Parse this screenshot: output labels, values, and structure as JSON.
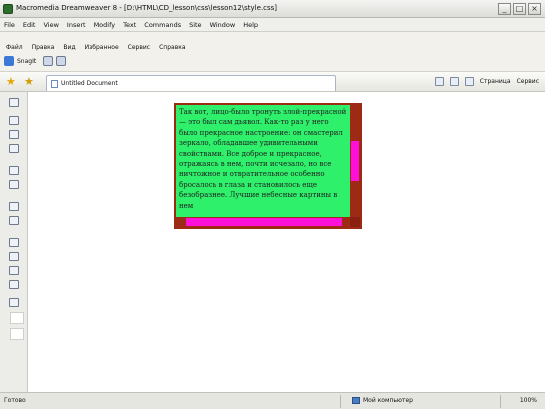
{
  "window": {
    "title": "Macromedia Dreamweaver 8 - [D:\\HTML\\CD_lesson\\css\\lesson12\\style.css]",
    "controls": [
      "_",
      "□",
      "×"
    ]
  },
  "dw_menu": [
    "File",
    "Edit",
    "View",
    "Insert",
    "Modify",
    "Text",
    "Commands",
    "Site",
    "Window",
    "Help"
  ],
  "ie_menu": [
    "Файл",
    "Правка",
    "Вид",
    "Избранное",
    "Сервис",
    "Справка"
  ],
  "ie_toolbar": {
    "snagit_label": "SnagIt"
  },
  "tab": {
    "title": "Untitled Document"
  },
  "ie_commands": {
    "page_label": "Страница",
    "tools_label": "Сервис"
  },
  "demo_box": {
    "text": "Так вот, лицо-было тронуть злой-прекрасной — это был сам дьявол. Как-то раз у него было прекрасное настроение: он смастерил зеркало, обладавшее удивительными свойствами. Все доброе и прекрасное, отражаясь в нем, почти исчезало, но все ничтожное и отвратительное особенно бросалось в глаза и становилось еще безобразнее. Лучшие небесные картины в нем",
    "colors": {
      "fill": "#2ef06a",
      "scrollbar_face": "#ff10d8",
      "scrollbar_track": "#9c2a14"
    }
  },
  "status": {
    "left": "Готово",
    "zone": "Мой компьютер",
    "zoom": "100%"
  }
}
